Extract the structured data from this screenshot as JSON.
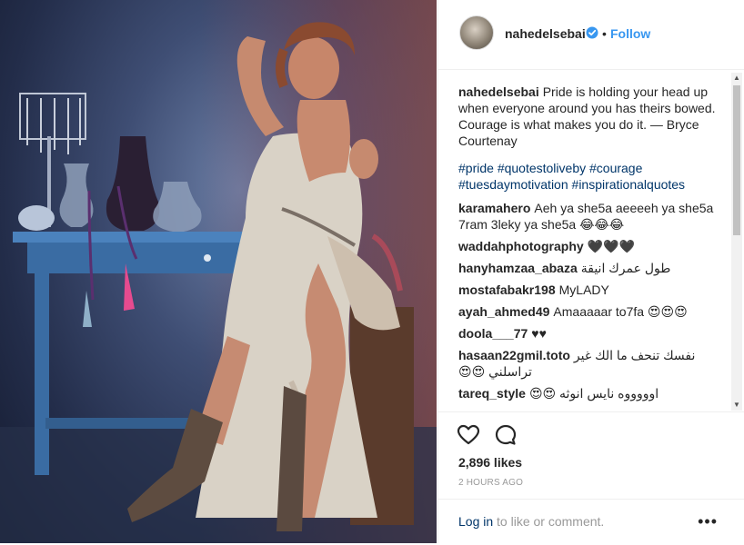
{
  "post": {
    "username": "nahedelsebai",
    "follow_label": "Follow",
    "separator": "•",
    "caption_text": "Pride is holding your head up when everyone around you has theirs bowed. Courage is what makes you do it. — Bryce Courtenay",
    "hashtags": [
      "#pride",
      "#quotestoliveby",
      "#courage",
      "#tuesdaymotivation",
      "#inspirationalquotes"
    ],
    "likes": "2,896 likes",
    "timestamp": "2 HOURS AGO"
  },
  "comments": [
    {
      "user": "karamahero",
      "text": "Aeh ya she5a aeeeeh ya she5a 7ram 3leky ya she5a 😂😂😂"
    },
    {
      "user": "waddahphotography",
      "text": "🖤🖤🖤"
    },
    {
      "user": "hanyhamzaa_abaza",
      "text": "طول عمرك انيقة"
    },
    {
      "user": "mostafabakr198",
      "text": "MyLADY"
    },
    {
      "user": "ayah_ahmed49",
      "text": "Amaaaaar to7fa 😍😍😍"
    },
    {
      "user": "doola___77",
      "text": "♥♥"
    },
    {
      "user": "hasaan22gmil.toto",
      "text": "نفسك تنحف ما الك غير تراسلني 😍😍"
    },
    {
      "user": "tareq_style",
      "text": "اوووووه نايس انوثه 😍😍"
    }
  ],
  "footer": {
    "login_link": "Log in",
    "login_rest": " to like or comment.",
    "more_label": "•••"
  },
  "icons": {
    "like": "heart-icon",
    "comment": "speech-bubble-icon",
    "verified": "verified-badge-icon",
    "more": "more-options-icon"
  },
  "colors": {
    "link_blue": "#3897f0",
    "hashtag": "#003569",
    "muted": "#999999"
  }
}
